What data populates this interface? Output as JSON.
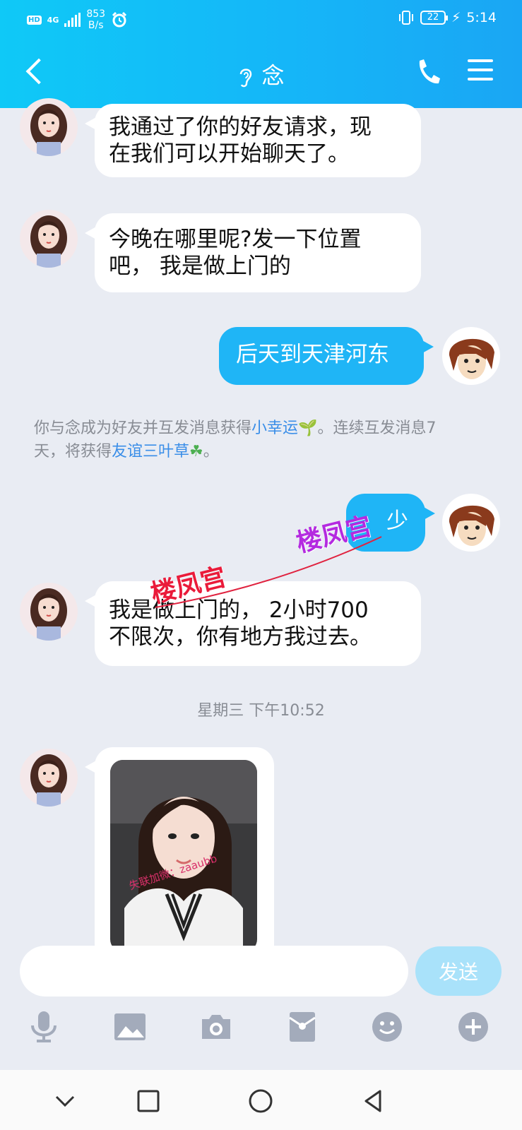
{
  "status_bar": {
    "hd": "HD",
    "network": "4G",
    "speed_value": "853",
    "speed_unit": "B/s",
    "battery": "22",
    "time": "5:14"
  },
  "header": {
    "title": "念",
    "color_start": "#0fc9f7",
    "color_end": "#1aa6f4",
    "icons": [
      "back-icon",
      "ear-icon",
      "phone-icon",
      "menu-icon"
    ]
  },
  "messages": [
    {
      "side": "in",
      "lines": [
        "我通过了你的好友请求，现",
        "在我们可以开始聊天了。"
      ]
    },
    {
      "side": "in",
      "lines": [
        "今晚在哪里呢?发一下位置",
        "吧， 我是做上门的"
      ]
    },
    {
      "side": "out",
      "lines": [
        "后天到天津河东"
      ]
    },
    {
      "side": "out",
      "lines": [
        "少"
      ]
    },
    {
      "side": "in",
      "lines": [
        "我是做上门的， 2小时700",
        "不限次，你有地方我过去。"
      ]
    }
  ],
  "system_message": {
    "part1": "你与念成为好友并互发消息获得",
    "link1": "小幸运",
    "part2": "。连续互发消息7",
    "part3": "天，将获得",
    "link2": "友谊三叶草",
    "part4": "。"
  },
  "timestamp": "星期三 下午10:52",
  "watermarks": [
    "楼凤宫",
    "楼凤宫"
  ],
  "photo_overlay_text": "失联加微：zaaubb",
  "input": {
    "placeholder": "",
    "send_label": "发送",
    "accent_color": "#1fb5f6"
  },
  "toolbar": [
    "mic-icon",
    "image-icon",
    "camera-icon",
    "red-packet-icon",
    "emoji-icon",
    "plus-icon"
  ],
  "system_nav": [
    "collapse-icon",
    "recents-icon",
    "home-icon",
    "back-nav-icon"
  ]
}
